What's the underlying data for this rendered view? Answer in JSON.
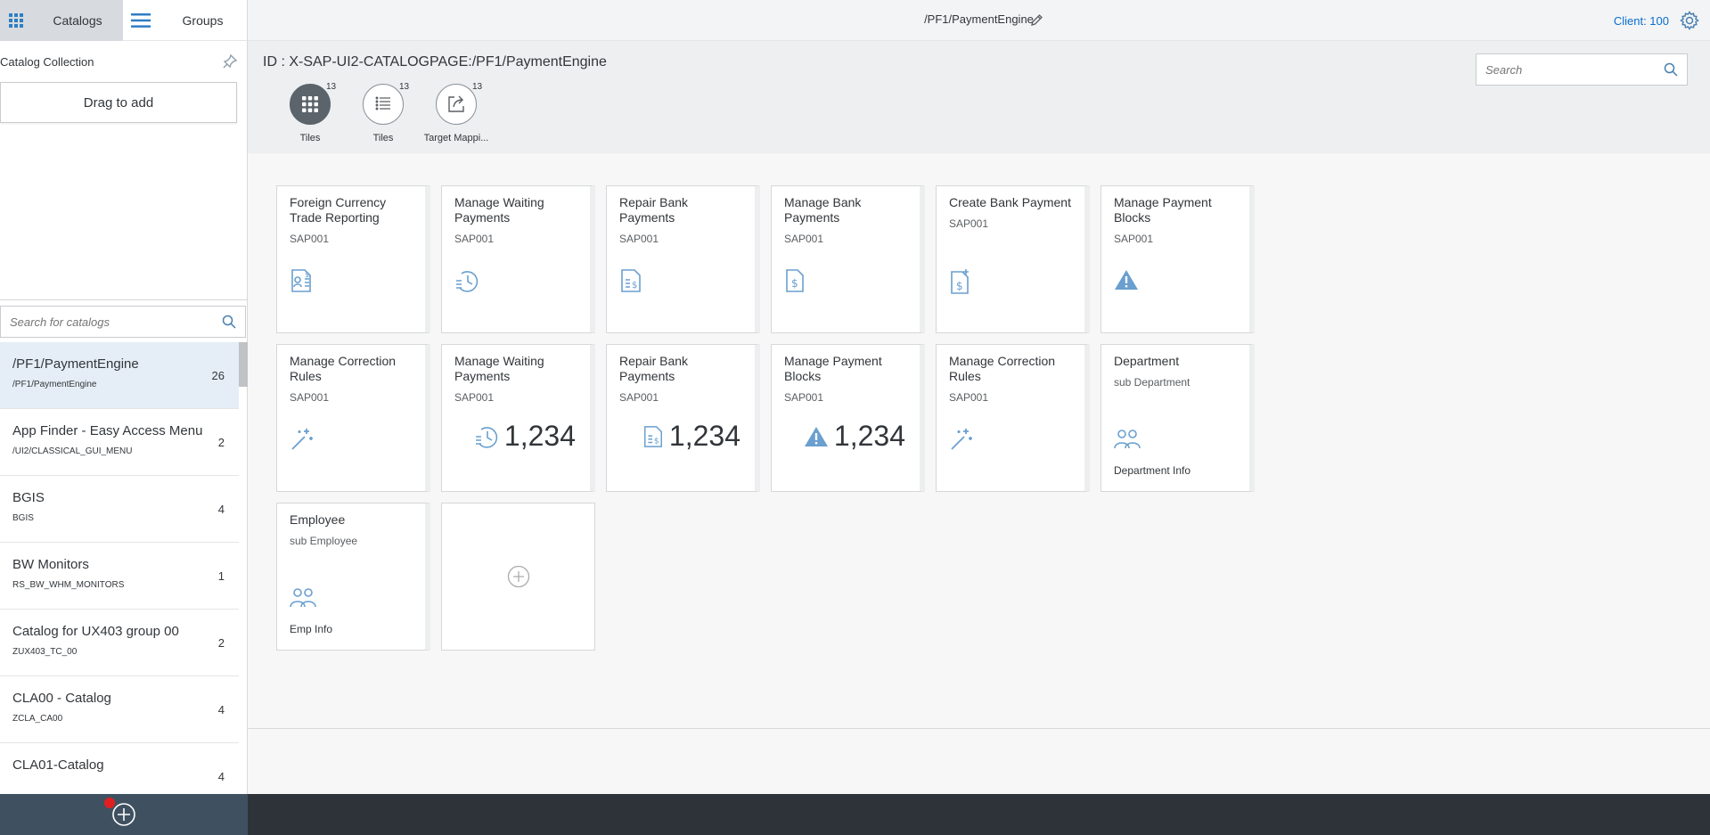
{
  "left_panel": {
    "tab_catalogs": "Catalogs",
    "tab_groups": "Groups",
    "collection_title": "Catalog Collection",
    "drag_label": "Drag to add",
    "search_placeholder": "Search for catalogs",
    "catalogs": [
      {
        "title": "/PF1/PaymentEngine",
        "sub": "/PF1/PaymentEngine",
        "count": "26"
      },
      {
        "title": "App Finder - Easy Access Menu",
        "sub": "/UI2/CLASSICAL_GUI_MENU",
        "count": "2"
      },
      {
        "title": "BGIS",
        "sub": "BGIS",
        "count": "4"
      },
      {
        "title": "BW Monitors",
        "sub": "RS_BW_WHM_MONITORS",
        "count": "1"
      },
      {
        "title": "Catalog for UX403 group 00",
        "sub": "ZUX403_TC_00",
        "count": "2"
      },
      {
        "title": "CLA00 - Catalog",
        "sub": "ZCLA_CA00",
        "count": "4"
      },
      {
        "title": "CLA01-Catalog",
        "sub": "",
        "count": "4"
      }
    ]
  },
  "topbar": {
    "title": "/PF1/PaymentEngine",
    "client": "Client: 100"
  },
  "header": {
    "page_id": "ID : X-SAP-UI2-CATALOGPAGE:/PF1/PaymentEngine",
    "search_placeholder": "Search",
    "tabs": [
      {
        "label": "Tiles",
        "count": "13",
        "icon": "grid-icon",
        "active": true
      },
      {
        "label": "Tiles",
        "count": "13",
        "icon": "list-icon",
        "active": false
      },
      {
        "label": "Target Mappi...",
        "count": "13",
        "icon": "share-icon",
        "active": false
      }
    ]
  },
  "tiles": [
    {
      "title": "Foreign Currency Trade Reporting",
      "sub": "SAP001",
      "icon": "document-dollar-icon"
    },
    {
      "title": "Manage Waiting Payments",
      "sub": "SAP001",
      "icon": "pending-clock-icon"
    },
    {
      "title": "Repair Bank Payments",
      "sub": "SAP001",
      "icon": "payment-doc-icon"
    },
    {
      "title": "Manage Bank Payments",
      "sub": "SAP001",
      "icon": "bank-doc-icon"
    },
    {
      "title": "Create Bank Payment",
      "sub": "SAP001",
      "icon": "create-payment-icon"
    },
    {
      "title": "Manage Payment Blocks",
      "sub": "SAP001",
      "icon": "warning-icon"
    },
    {
      "title": "Manage Correction Rules",
      "sub": "SAP001",
      "icon": "magic-wand-icon"
    },
    {
      "title": "Manage Waiting Payments",
      "sub": "SAP001",
      "icon": "pending-clock-icon",
      "kpi": "1,234"
    },
    {
      "title": "Repair Bank Payments",
      "sub": "SAP001",
      "icon": "payment-doc-icon",
      "kpi": "1,234"
    },
    {
      "title": "Manage Payment Blocks",
      "sub": "SAP001",
      "icon": "warning-icon",
      "kpi": "1,234"
    },
    {
      "title": "Manage Correction Rules",
      "sub": "SAP001",
      "icon": "magic-wand-icon"
    },
    {
      "title": "Department",
      "sub": "sub Department",
      "icon": "group-icon",
      "footer": "Department Info"
    },
    {
      "title": "Employee",
      "sub": "sub Employee",
      "icon": "group-icon",
      "footer": "Emp Info"
    }
  ],
  "colors": {
    "accent": "#0a6ed1",
    "icon_blue": "#6a9fcf",
    "bottom_bar": "#2d3338",
    "left_bottom_bar": "#3f5161"
  }
}
